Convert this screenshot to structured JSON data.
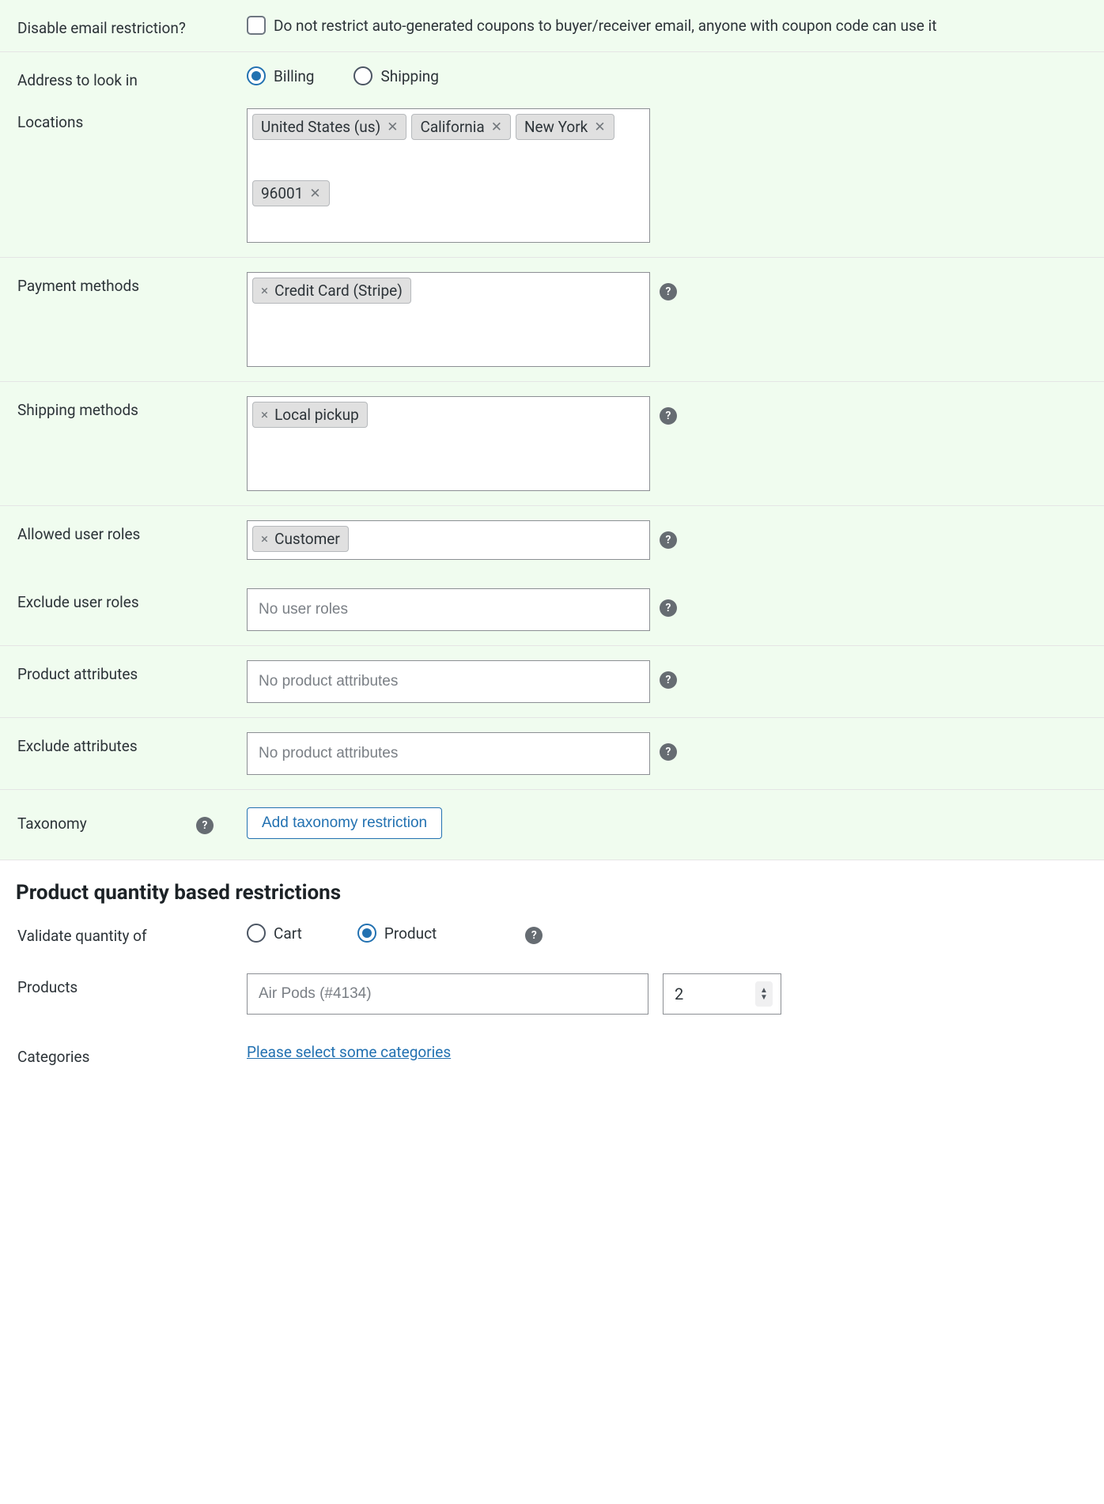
{
  "email": {
    "label": "Disable email restriction?",
    "desc": "Do not restrict auto-generated coupons to buyer/receiver email, anyone with coupon code can use it"
  },
  "address": {
    "label": "Address to look in",
    "options": {
      "billing": "Billing",
      "shipping": "Shipping"
    },
    "selected": "billing"
  },
  "locations": {
    "label": "Locations",
    "tags": [
      "United States (us)",
      "California",
      "New York",
      "96001"
    ]
  },
  "payment": {
    "label": "Payment methods",
    "tags": [
      "Credit Card (Stripe)"
    ]
  },
  "shipping": {
    "label": "Shipping methods",
    "tags": [
      "Local pickup"
    ]
  },
  "allowed_roles": {
    "label": "Allowed user roles",
    "tags": [
      "Customer"
    ]
  },
  "exclude_roles": {
    "label": "Exclude user roles",
    "placeholder": "No user roles"
  },
  "product_attrs": {
    "label": "Product attributes",
    "placeholder": "No product attributes"
  },
  "exclude_attrs": {
    "label": "Exclude attributes",
    "placeholder": "No product attributes"
  },
  "taxonomy": {
    "label": "Taxonomy",
    "button": "Add taxonomy restriction"
  },
  "qty_section": {
    "heading": "Product quantity based restrictions",
    "validate_label": "Validate quantity of",
    "options": {
      "cart": "Cart",
      "product": "Product"
    },
    "selected": "product",
    "products_label": "Products",
    "product_placeholder": "Air Pods (#4134)",
    "qty_value": "2",
    "categories_label": "Categories",
    "categories_link": "Please select some categories"
  },
  "icons": {
    "help": "?",
    "close": "✕",
    "close_small": "×",
    "up": "▲",
    "down": "▼"
  }
}
